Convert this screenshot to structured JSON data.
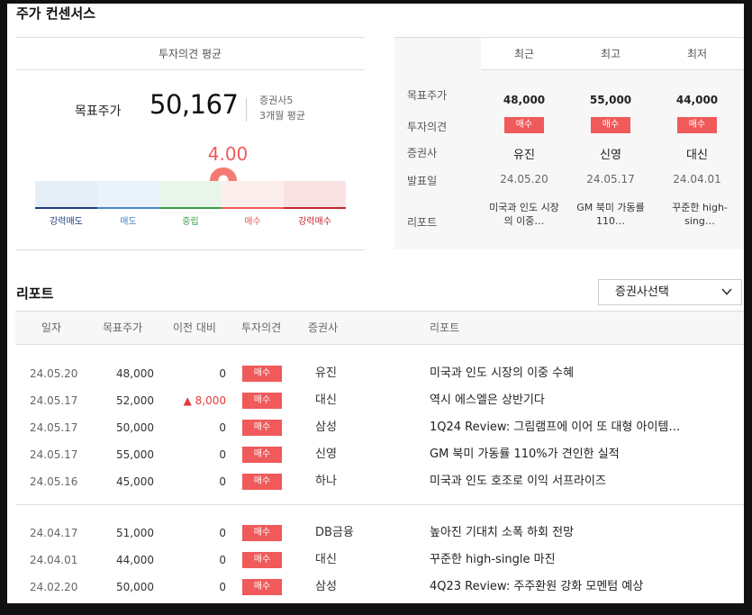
{
  "section_title": "주가 컨센서스",
  "consensus": {
    "header": "투자의견 평균",
    "target_label": "목표주가",
    "target_value": "50,167",
    "brokers": "증권사5",
    "period": "3개월 평균",
    "score": "4.00",
    "score_value": 4.0,
    "scale_labels": [
      "강력매도",
      "매도",
      "중립",
      "매수",
      "강력매수"
    ],
    "scale_colors": [
      "#1f3f7a",
      "#4a86c8",
      "#3a9a4a",
      "#f05a5a",
      "#c0282d"
    ],
    "scale_fills": [
      "#e6eef8",
      "#eaf2fb",
      "#e9f5ea",
      "#fdeeee",
      "#fbe2e2"
    ]
  },
  "compare": {
    "headers": [
      "최근",
      "최고",
      "최저"
    ],
    "row_labels": [
      "목표주가",
      "투자의견",
      "증권사",
      "발표일",
      "리포트"
    ],
    "columns": [
      {
        "target": "48,000",
        "opinion": "매수",
        "broker": "유진",
        "date": "24.05.20",
        "report": "미국과 인도 시장의 이중…"
      },
      {
        "target": "55,000",
        "opinion": "매수",
        "broker": "신영",
        "date": "24.05.17",
        "report": "GM 북미 가동률 110…"
      },
      {
        "target": "44,000",
        "opinion": "매수",
        "broker": "대신",
        "date": "24.04.01",
        "report": "꾸준한 high-sing…"
      }
    ]
  },
  "reports": {
    "title": "리포트",
    "broker_select": "증권사선택",
    "headers": [
      "일자",
      "목표주가",
      "이전 대비",
      "투자의견",
      "증권사",
      "리포트"
    ],
    "rows": [
      {
        "date": "24.05.20",
        "target": "48,000",
        "change": "0",
        "opinion": "매수",
        "broker": "유진",
        "title": "미국과 인도 시장의 이중 수혜"
      },
      {
        "date": "24.05.17",
        "target": "52,000",
        "change": "▲ 8,000",
        "opinion": "매수",
        "broker": "대신",
        "title": "역시 에스엘은 상반기다"
      },
      {
        "date": "24.05.17",
        "target": "50,000",
        "change": "0",
        "opinion": "매수",
        "broker": "삼성",
        "title": "1Q24 Review: 그림램프에 이어 또 대형 아이템…"
      },
      {
        "date": "24.05.17",
        "target": "55,000",
        "change": "0",
        "opinion": "매수",
        "broker": "신영",
        "title": "GM 북미 가동률 110%가 견인한 실적"
      },
      {
        "date": "24.05.16",
        "target": "45,000",
        "change": "0",
        "opinion": "매수",
        "broker": "하나",
        "title": "미국과 인도 호조로 이익 서프라이즈"
      },
      {
        "date": "24.04.17",
        "target": "51,000",
        "change": "0",
        "opinion": "매수",
        "broker": "DB금융",
        "title": "높아진 기대치 소폭 하회 전망"
      },
      {
        "date": "24.04.01",
        "target": "44,000",
        "change": "0",
        "opinion": "매수",
        "broker": "대신",
        "title": "꾸준한 high-single 마진"
      },
      {
        "date": "24.02.20",
        "target": "50,000",
        "change": "0",
        "opinion": "매수",
        "broker": "삼성",
        "title": "4Q23 Review: 주주환원 강화 모멘텀 예상"
      }
    ]
  }
}
